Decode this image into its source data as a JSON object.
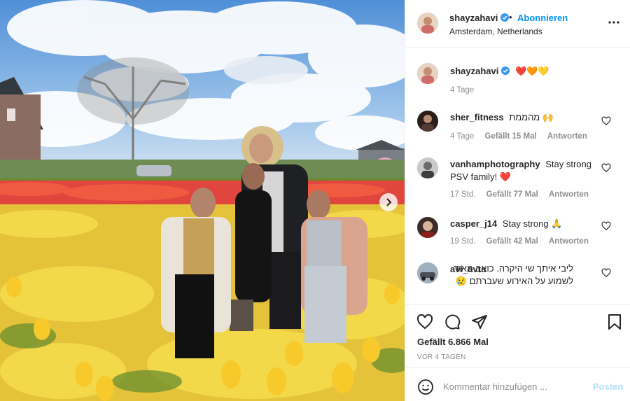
{
  "photo": {
    "alt_hint_icon": "next-photo-arrow"
  },
  "header": {
    "username": "shayzahavi",
    "follow_label": "Abonnieren",
    "separator": "•",
    "location": "Amsterdam, Netherlands",
    "more_icon": "more-options-icon"
  },
  "caption": {
    "username": "shayzahavi",
    "emojis": "❤️🧡💛",
    "time": "4 Tage"
  },
  "comments": [
    {
      "username": "sher_fitness",
      "text": "מהממת 🙌",
      "time": "4 Tage",
      "likes": "Gefällt 15 Mal",
      "reply": "Antworten"
    },
    {
      "username": "vanhamphotography",
      "text": "Stay strong PSV family! ❤️",
      "time": "17 Std.",
      "likes": "Gefällt 77 Mal",
      "reply": "Antworten"
    },
    {
      "username": "casper_j14",
      "text": "Stay strong 🙏",
      "time": "19 Std.",
      "likes": "Gefällt 42 Mal",
      "reply": "Antworten"
    },
    {
      "username": "avi_avta",
      "text": "ליבי איתך שי היקרה. כואב מאוד לשמוע על האירוע שעברתם 😢"
    }
  ],
  "actions": {
    "like_icon": "heart-icon",
    "comment_icon": "comment-icon",
    "share_icon": "share-icon",
    "save_icon": "bookmark-icon",
    "likes": "Gefällt 6.866 Mal",
    "date": "VOR 4 TAGEN"
  },
  "comment_box": {
    "placeholder": "Kommentar hinzufügen ...",
    "post_label": "Posten"
  },
  "colors": {
    "accent": "#0095f6",
    "post_disabled": "#b2dffc",
    "muted": "#8e8e8e",
    "heart_red": "#ed4956"
  }
}
